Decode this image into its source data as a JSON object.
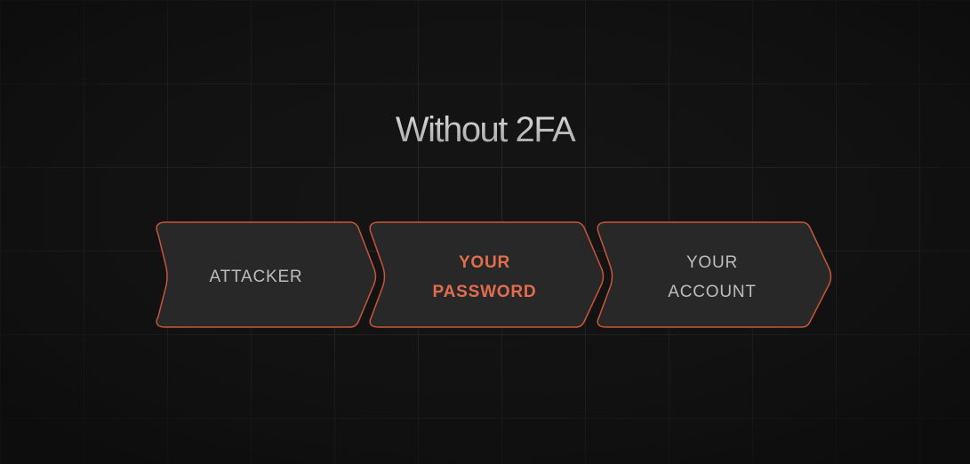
{
  "title": "Without 2FA",
  "colors": {
    "background": "#141414",
    "grid": "#2a2a2a",
    "step_fill": "#282828",
    "step_border": "#c9563b",
    "accent_text": "#e26d4e",
    "normal_text": "#bdbdbd"
  },
  "steps": [
    {
      "label": "ATTACKER",
      "style": "normal"
    },
    {
      "label": "YOUR\nPASSWORD",
      "style": "highlight"
    },
    {
      "label": "YOUR\nACCOUNT",
      "style": "normal"
    }
  ]
}
